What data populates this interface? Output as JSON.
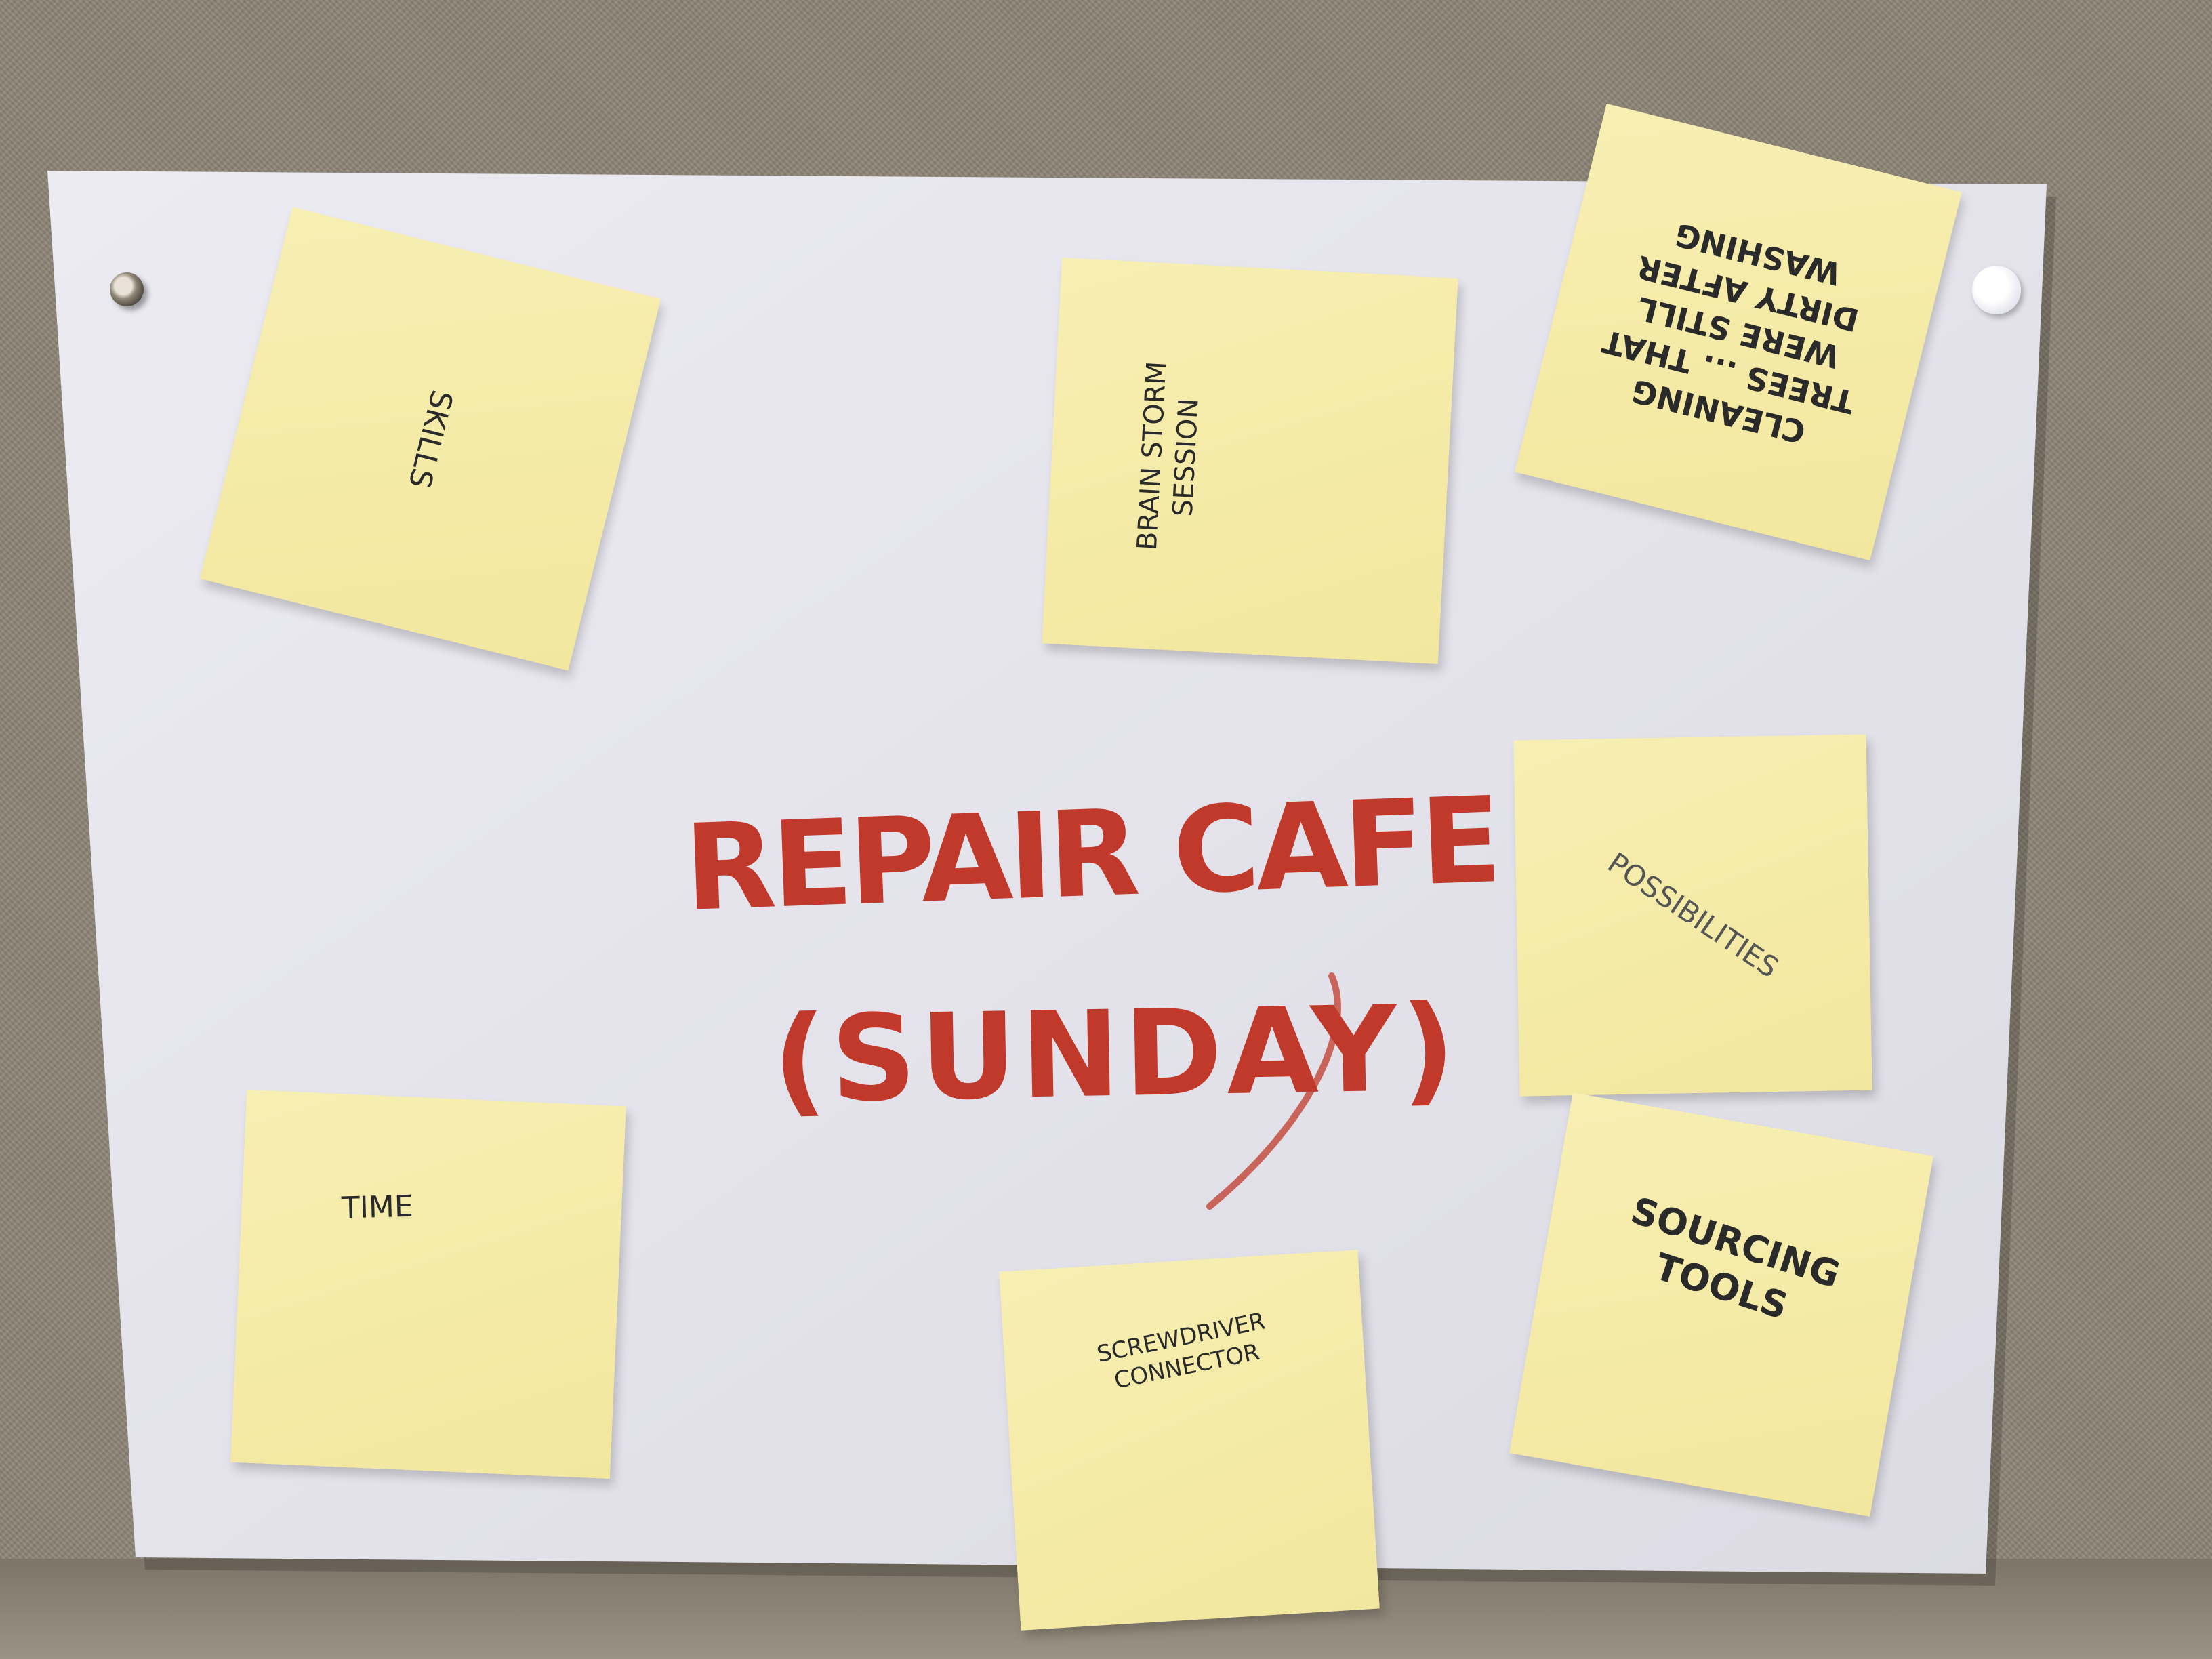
{
  "colors": {
    "wall": "#8c8476",
    "paper": "#e4e3eb",
    "note": "#f4eba6",
    "marker_red": "#c0392b",
    "ink": "#2a2a2a"
  },
  "title": {
    "line1": "REPAIR CAFE",
    "line2": "(SUNDAY)"
  },
  "notes": {
    "skills": "SKILLS",
    "brainstorm": "BRAIN STORM\nSESSION",
    "cleaning": "CLEANING\nTREES ... THAT\nWERE STILL\nDIRTY AFTER\nWASHING",
    "possibilities": "POSSIBILITIES",
    "time": "TIME",
    "screwdriver": "SCREWDRIVER\nCONNECTOR",
    "sourcing": "SOURCING\nTOOLS"
  }
}
